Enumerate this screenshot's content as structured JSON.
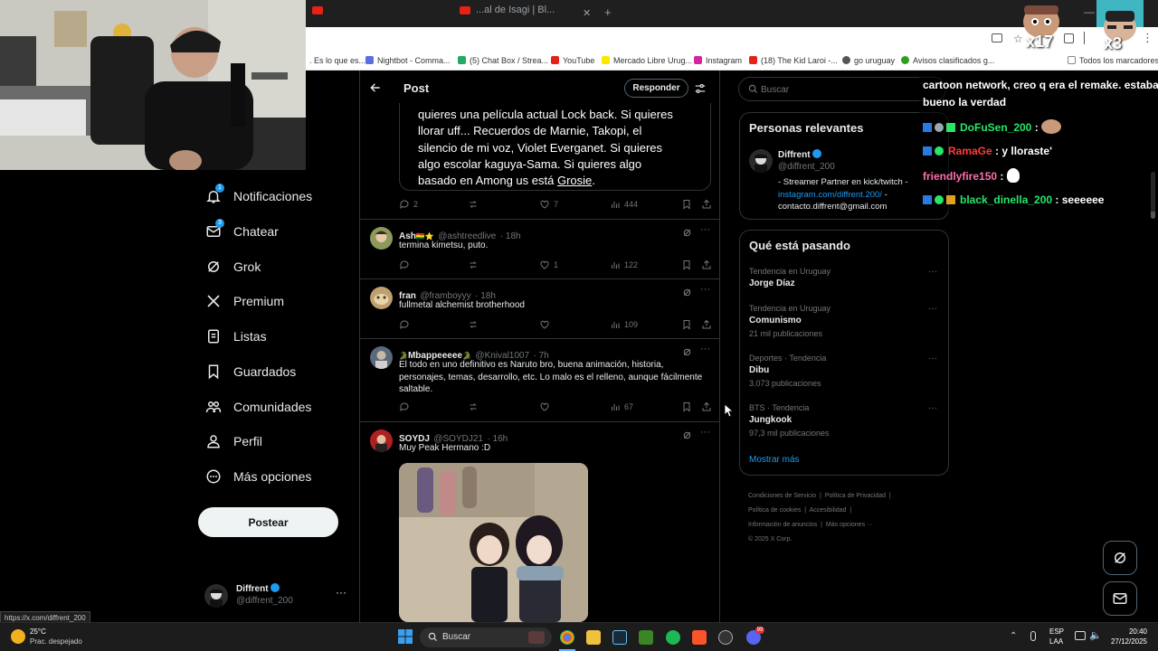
{
  "browser": {
    "tabs": [
      {
        "label": ""
      },
      {
        "label": "...al de Isagi | Bl..."
      }
    ],
    "bookmarks": [
      {
        "label": ". Es lo que es...",
        "color": "#666666"
      },
      {
        "label": "Nightbot - Comma...",
        "color": "#5a6ee0"
      },
      {
        "label": "(5) Chat Box / Strea...",
        "color": "#22aa66"
      },
      {
        "label": "YouTube",
        "color": "#e62117"
      },
      {
        "label": "Mercado Libre Urug...",
        "color": "#ffe600"
      },
      {
        "label": "Instagram",
        "color": "#d6249f"
      },
      {
        "label": "(18) The Kid Laroi -...",
        "color": "#e62117"
      },
      {
        "label": "go uruguay",
        "color": "#555555"
      },
      {
        "label": "Avisos clasificados g...",
        "color": "#2ca01c"
      },
      {
        "label": "Todos los marcadores",
        "color": "#888888"
      }
    ],
    "overlay_counters": [
      "x17",
      "x3"
    ],
    "status_url": "https://x.com/diffrent_200"
  },
  "nav": {
    "items": [
      {
        "label": "Notificaciones",
        "icon": "bell-icon",
        "badge": "1"
      },
      {
        "label": "Chatear",
        "icon": "mail-icon",
        "badge": "3"
      },
      {
        "label": "Grok",
        "icon": "grok-icon"
      },
      {
        "label": "Premium",
        "icon": "x-logo-icon"
      },
      {
        "label": "Listas",
        "icon": "list-icon"
      },
      {
        "label": "Guardados",
        "icon": "bookmark-icon"
      },
      {
        "label": "Comunidades",
        "icon": "people-icon"
      },
      {
        "label": "Perfil",
        "icon": "person-icon"
      },
      {
        "label": "Más opciones",
        "icon": "more-circle-icon"
      }
    ],
    "post_button": "Postear",
    "account": {
      "name": "Diffrent",
      "handle": "@diffrent_200"
    }
  },
  "post_header": {
    "title": "Post",
    "reply_button": "Responder"
  },
  "main_post": {
    "text_lines": [
      "quieres una película actual Lock back. Si quieres",
      "llorar uff... Recuerdos de Marnie, Takopi, el",
      "silencio de mi voz, Violet Everganet. Si quieres",
      "algo escolar kaguya-Sama. Si quieres algo",
      "basado en Among us está "
    ],
    "link": "Grosie",
    "text_end": ".",
    "replies": "2",
    "likes": "7",
    "views": "444"
  },
  "replies": [
    {
      "name": "Ash",
      "name_suffix": "🇧🇴⭐",
      "handle": "@ashtreedlive",
      "time": "· 18h",
      "text": [
        "termina kimetsu, puto."
      ],
      "replies": "",
      "retweets": "",
      "likes": "1",
      "views": "122"
    },
    {
      "name": "fran",
      "name_suffix": "",
      "handle": "@framboyyy",
      "time": "· 18h",
      "text": [
        "fullmetal alchemist brotherhood"
      ],
      "replies": "",
      "retweets": "",
      "likes": "",
      "views": "109"
    },
    {
      "name": "Mbappeeeee",
      "name_suffix": "🐊",
      "name_prefix": "🐊",
      "handle": "@Knival1007",
      "time": "· 7h",
      "text": [
        "El todo en uno definitivo es Naruto bro, buena animación, historia,",
        "personajes, temas, desarrollo, etc. Lo malo es el relleno, aunque fácilmente",
        "saltable."
      ],
      "replies": "",
      "retweets": "",
      "likes": "",
      "views": "67"
    },
    {
      "name": "SOYDJ",
      "name_suffix": "",
      "handle": "@SOYDJ21",
      "time": "· 16h",
      "text": [
        "Muy Peak Hermano :D"
      ]
    }
  ],
  "search": {
    "placeholder": "Buscar"
  },
  "relevant": {
    "title": "Personas relevantes",
    "name": "Diffrent",
    "handle": "@diffrent_200",
    "bio_lines": [
      "- Streamer Partner en kick/twitch -"
    ],
    "bio_link": "instagram.com/diffrent.200/",
    "bio_after_link": " -",
    "bio_email": "contacto.diffrent@gmail.com"
  },
  "trends": {
    "title": "Qué está pasando",
    "items": [
      {
        "context": "Tendencia en Uruguay",
        "name": "Jorge Díaz",
        "count": ""
      },
      {
        "context": "Tendencia en Uruguay",
        "name": "Comunismo",
        "count": "21 mil publicaciones"
      },
      {
        "context": "Deportes · Tendencia",
        "name": "Dibu",
        "count": "3.073 publicaciones"
      },
      {
        "context": "BTS · Tendencia",
        "name": "Jungkook",
        "count": "97,3 mil publicaciones"
      }
    ],
    "show_more": "Mostrar más"
  },
  "footer_links": {
    "row1": [
      "Condiciones de Servicio",
      "Política de Privacidad"
    ],
    "row2": [
      "Política de cookies",
      "Accesibilidad"
    ],
    "row3": [
      "Información de anuncios",
      "Más opciones ···"
    ],
    "copyright": "© 2025 X Corp."
  },
  "chat": {
    "messages": [
      {
        "user": "",
        "text": "cartoon network, creo q era el remake. estaba",
        "color": "#ffffff"
      },
      {
        "user": "",
        "text": "bueno la verdad",
        "color": "#ffffff"
      },
      {
        "user": "DoFuSen_200",
        "text": ":",
        "color": "#27e66a"
      },
      {
        "user": "RamaGe",
        "text": ": y lloraste'",
        "color": "#ff3b3b"
      },
      {
        "user": "friendlyfire150",
        "text": ":",
        "color": "#ff6fae"
      },
      {
        "user": "black_dinella_200",
        "text": ": seeeeee",
        "color": "#27e66a"
      }
    ]
  },
  "taskbar": {
    "weather_temp": "25°C",
    "weather_desc": "Prac. despejado",
    "search_placeholder": "Buscar",
    "lang_top": "ESP",
    "lang_bottom": "LAA",
    "time": "20:40",
    "date": "27/12/2025",
    "discord_badge": "99"
  }
}
